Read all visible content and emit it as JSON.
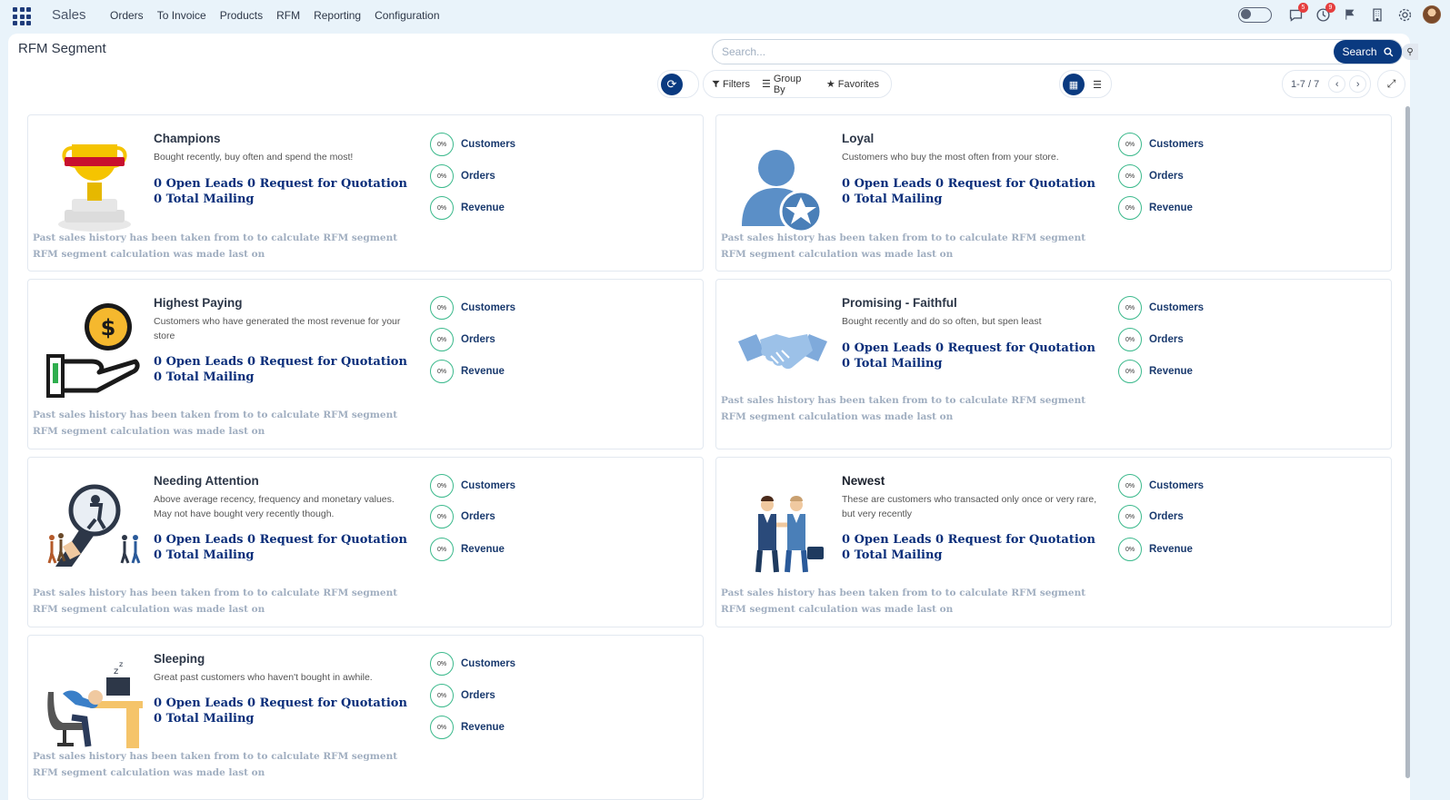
{
  "navbar": {
    "brand": "Sales",
    "menu": [
      "Orders",
      "To Invoice",
      "Products",
      "RFM",
      "Reporting",
      "Configuration"
    ],
    "badges": {
      "messages": "5",
      "activities": "9"
    }
  },
  "control": {
    "page_title": "RFM Segment",
    "search_placeholder": "Search...",
    "search_label": "Search",
    "filters_label": "Filters",
    "groupby_label": "Group By",
    "favorites_label": "Favorites",
    "pager": "1-7 / 7"
  },
  "colors": {
    "primary": "#0a3a80",
    "metric_ring": "#3bb98c",
    "stats_text": "#0a2e7a",
    "footer_text": "#a0aec0"
  },
  "common": {
    "stats_line1": "0 Open Leads 0 Request for Quotation",
    "stats_line2": "0 Total Mailing",
    "footer_line1": "Past sales history has been taken from to to calculate RFM segment",
    "footer_line2": "RFM segment calculation was made last on",
    "metric_customers": "Customers",
    "metric_orders": "Orders",
    "metric_revenue": "Revenue",
    "pct": "0%"
  },
  "segments": [
    {
      "title": "Champions",
      "desc": "Bought recently, buy often and spend the most!",
      "icon": "trophy-icon"
    },
    {
      "title": "Loyal",
      "desc": "Customers who buy the most often from your store.",
      "icon": "loyal-user-star-icon"
    },
    {
      "title": "Highest Paying",
      "desc": "Customers who have generated the most revenue for your store",
      "icon": "hand-dollar-icon"
    },
    {
      "title": "Promising - Faithful",
      "desc": "Bought recently and do so often, but spen least",
      "icon": "handshake-icon"
    },
    {
      "title": "Needing Attention",
      "desc": "Above average recency, frequency and monetary values. May not have bought very recently though.",
      "icon": "magnifier-people-icon"
    },
    {
      "title": "Newest",
      "desc": "These are customers who transacted only once or very rare, but very recently",
      "icon": "businessmen-handshake-icon"
    },
    {
      "title": "Sleeping",
      "desc": "Great past customers who haven't bought in awhile.",
      "icon": "sleeping-desk-icon"
    }
  ]
}
